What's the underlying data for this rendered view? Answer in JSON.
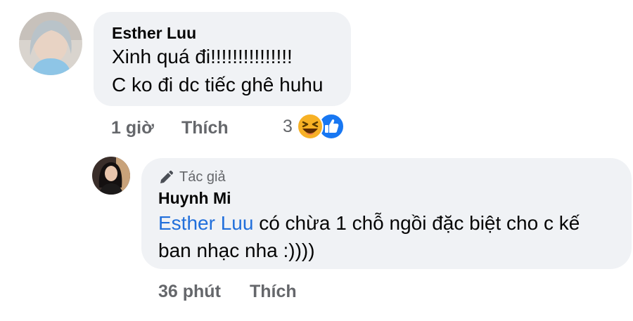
{
  "comment": {
    "author": "Esther Luu",
    "lines": [
      "Xinh quá đi!!!!!!!!!!!!!!!",
      "C ko đi dc tiếc ghê huhu"
    ],
    "time": "1 giờ",
    "like_label": "Thích",
    "reaction_count": "3",
    "reaction_icons": [
      "haha-icon",
      "like-icon"
    ]
  },
  "reply": {
    "author_badge_icon": "pencil-icon",
    "author_badge": "Tác giả",
    "author": "Huynh Mi",
    "mention": "Esther Luu",
    "text_line1": " có chừa 1 chỗ ngồi đặc biệt cho c kế",
    "text_line2": "ban nhạc nha :))))",
    "time": "36 phút",
    "like_label": "Thích"
  },
  "colors": {
    "bubble": "#f0f2f5",
    "meta_text": "#65676b",
    "mention": "#216fdb",
    "like_blue": "#1877f2",
    "haha_yellow": "#f7b125"
  }
}
